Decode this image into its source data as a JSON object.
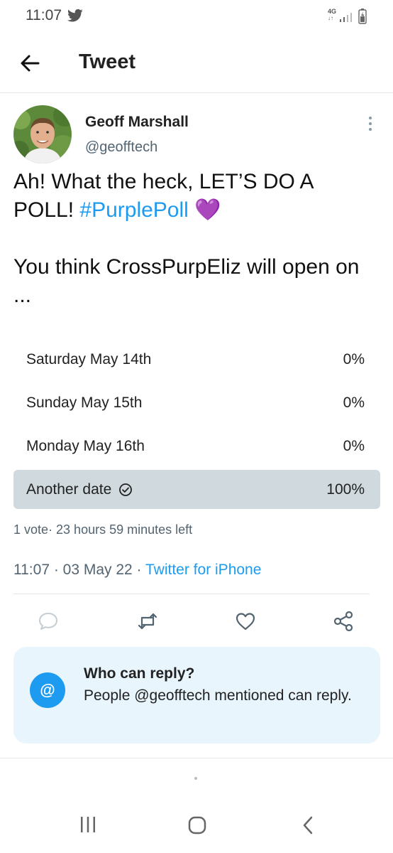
{
  "status_bar": {
    "time": "11:07",
    "network": "4G",
    "icons": [
      "twitter-icon",
      "signal-icon",
      "battery-icon"
    ]
  },
  "header": {
    "back_icon": "arrow-left-icon",
    "title": "Tweet"
  },
  "tweet": {
    "author_name": "Geoff Marshall",
    "author_handle": "@geofftech",
    "text_line1_plain": "Ah! What the heck, LET’S DO A POLL! ",
    "hashtag": "#PurplePoll",
    "emoji": "💜",
    "text_paragraph2": "You think CrossPurpEliz will open on ..."
  },
  "poll": {
    "options": [
      {
        "label": "Saturday May 14th",
        "percent": "0%",
        "fraction": 0,
        "selected": false
      },
      {
        "label": "Sunday May 15th",
        "percent": "0%",
        "fraction": 0,
        "selected": false
      },
      {
        "label": "Monday May 16th",
        "percent": "0%",
        "fraction": 0,
        "selected": false
      },
      {
        "label": "Another date",
        "percent": "100%",
        "fraction": 1,
        "selected": true
      }
    ],
    "meta": "1 vote· 23 hours 59 minutes left"
  },
  "meta": {
    "timestamp": "11:07 · 03 May 22 · ",
    "source": "Twitter for iPhone"
  },
  "actions": [
    "reply-icon",
    "retweet-icon",
    "like-icon",
    "share-icon"
  ],
  "reply_restriction": {
    "icon_symbol": "@",
    "title": "Who can reply?",
    "description": "People @geofftech mentioned can reply."
  },
  "colors": {
    "accent": "#1d9bf0",
    "poll_fill": "#cfd9de",
    "card_bg": "#e8f5fd"
  }
}
